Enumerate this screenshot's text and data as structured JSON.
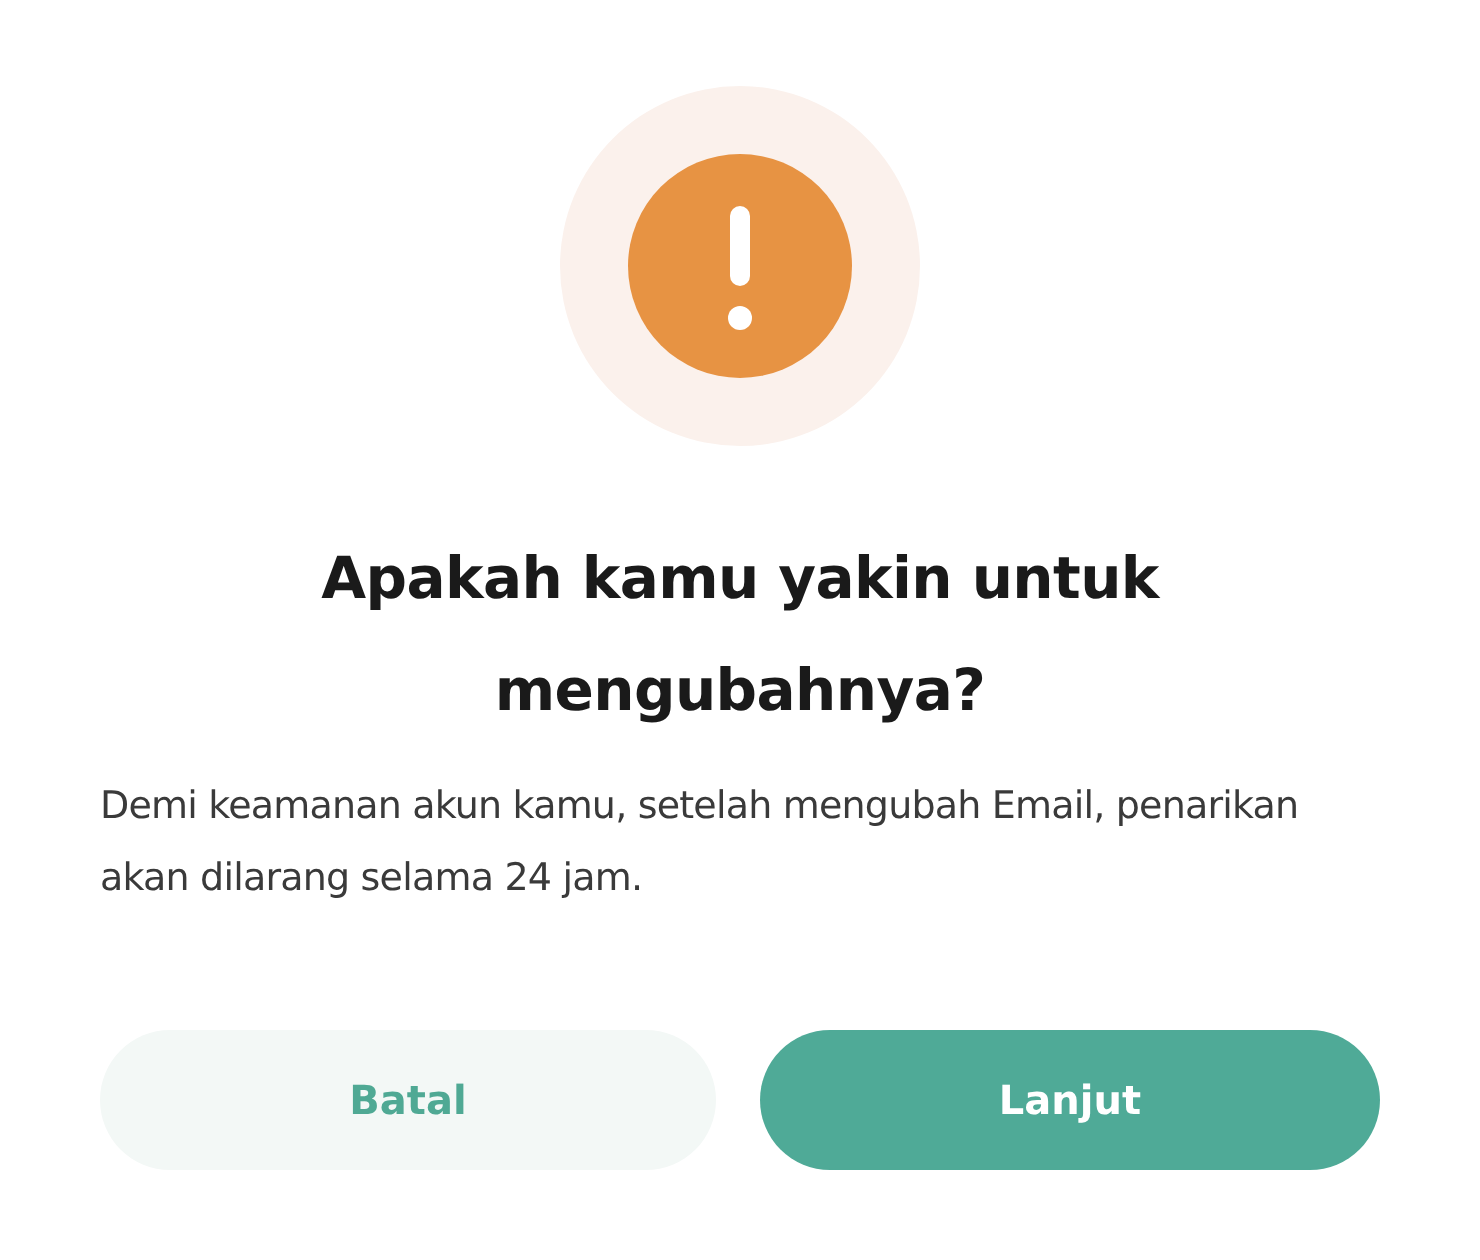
{
  "dialog": {
    "title": "Apakah kamu yakin untuk mengubahnya?",
    "message": "Demi keamanan akun kamu, setelah mengubah Email, penarikan akan dilarang selama 24 jam.",
    "buttons": [
      {
        "label": "Batal",
        "kind": "secondary"
      },
      {
        "label": "Lanjut",
        "kind": "primary"
      }
    ]
  }
}
